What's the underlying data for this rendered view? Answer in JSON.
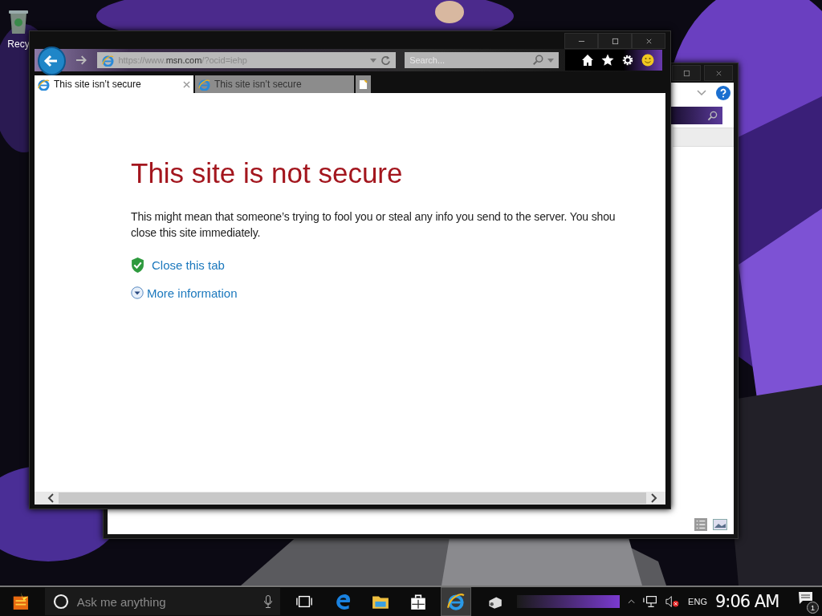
{
  "desktop": {
    "icons": [
      {
        "label": "Recy"
      }
    ]
  },
  "browser": {
    "address": "https://www.**msn.com**/?ocid=iehp",
    "search": {
      "placeholder": "Search..."
    },
    "tabs": [
      {
        "title": "This site isn’t secure",
        "selected": true
      },
      {
        "title": "This site isn’t secure",
        "selected": false
      }
    ],
    "page": {
      "heading": "This site is not secure",
      "paragraph": [
        "This might mean that someone’s trying to fool you or steal any info you send to the server. You shou",
        "close this site immediately."
      ],
      "links": [
        {
          "kind": "shield",
          "label": "Close this tab"
        },
        {
          "kind": "expand",
          "label": "More information"
        }
      ]
    }
  },
  "taskbar": {
    "search": {
      "placeholder": "Ask me anything"
    },
    "apps": [
      {
        "kind": "edge",
        "selected": false
      },
      {
        "kind": "folder",
        "selected": false
      },
      {
        "kind": "store",
        "selected": false
      },
      {
        "kind": "ie",
        "selected": true
      },
      {
        "kind": "app",
        "selected": false
      }
    ],
    "language": "ENG",
    "clock": "9:06 AM",
    "notifications": "1"
  }
}
